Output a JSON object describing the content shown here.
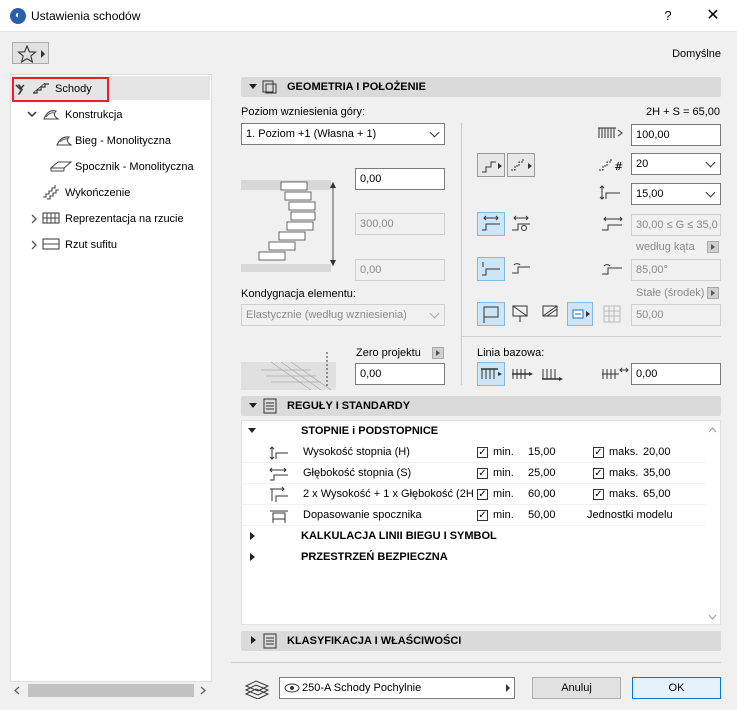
{
  "window": {
    "title": "Ustawienia schodów",
    "help": "?",
    "close": "✕"
  },
  "preset": "Domyślne",
  "tree": {
    "items": [
      {
        "label": "Schody",
        "icon": "stair-icon"
      },
      {
        "label": "Konstrukcja",
        "icon": "construction-icon"
      },
      {
        "label": "Bieg - Monolityczna",
        "icon": "flight-icon"
      },
      {
        "label": "Spocznik - Monolityczna",
        "icon": "landing-icon"
      },
      {
        "label": "Wykończenie",
        "icon": "finish-icon"
      },
      {
        "label": "Reprezentacja na rzucie",
        "icon": "floorplan-icon"
      },
      {
        "label": "Rzut sufitu",
        "icon": "ceiling-icon"
      }
    ]
  },
  "geometry": {
    "header": "GEOMETRIA I POŁOŻENIE",
    "top_level_label": "Poziom wzniesienia góry:",
    "top_level_value": "1. Poziom +1 (Własna + 1)",
    "top_offset": "0,00",
    "height_value": "300,00",
    "bottom_offset": "0,00",
    "story_label": "Kondygnacja elementu:",
    "story_value": "Elastycznie (według wzniesienia)",
    "zero_label": "Zero projektu",
    "zero_value": "0,00",
    "formula": "2H + S = 65,00",
    "total_rise": "100,00",
    "risers_count": "20",
    "tread_depth": "15,00",
    "going_range": "30,00 ≤ G ≤ 35,0",
    "by_angle_label": "według kąta",
    "angle_value": "85,00°",
    "constant_label": "Stałe (środek)",
    "constant_value": "50,00",
    "baseline_label": "Linia bazowa:",
    "baseline_offset": "0,00"
  },
  "rules": {
    "header": "REGUŁY I STANDARDY",
    "group_open": "STOPNIE i PODSTOPNICE",
    "rows": [
      {
        "name": "Wysokość stopnia (H)",
        "min_label": "min.",
        "min": "15,00",
        "max_label": "maks.",
        "max": "20,00"
      },
      {
        "name": "Głębokość stopnia (S)",
        "min_label": "min.",
        "min": "25,00",
        "max_label": "maks.",
        "max": "35,00"
      },
      {
        "name": "2 x Wysokość + 1 x Głębokość (2H",
        "min_label": "min.",
        "min": "60,00",
        "max_label": "maks.",
        "max": "65,00"
      },
      {
        "name": "Dopasowanie spocznika",
        "min_label": "min.",
        "min": "50,00",
        "max_label": "",
        "max": "Jednostki modelu"
      }
    ],
    "group_calc": "KALKULACJA LINII BIEGU I SYMBOL",
    "group_space": "PRZESTRZEŃ BEZPIECZNA"
  },
  "classification": {
    "header": "KLASYFIKACJA I WŁAŚCIWOŚCI"
  },
  "footer": {
    "layer": "250-A Schody Pochylnie",
    "cancel": "Anuluj",
    "ok": "OK"
  }
}
